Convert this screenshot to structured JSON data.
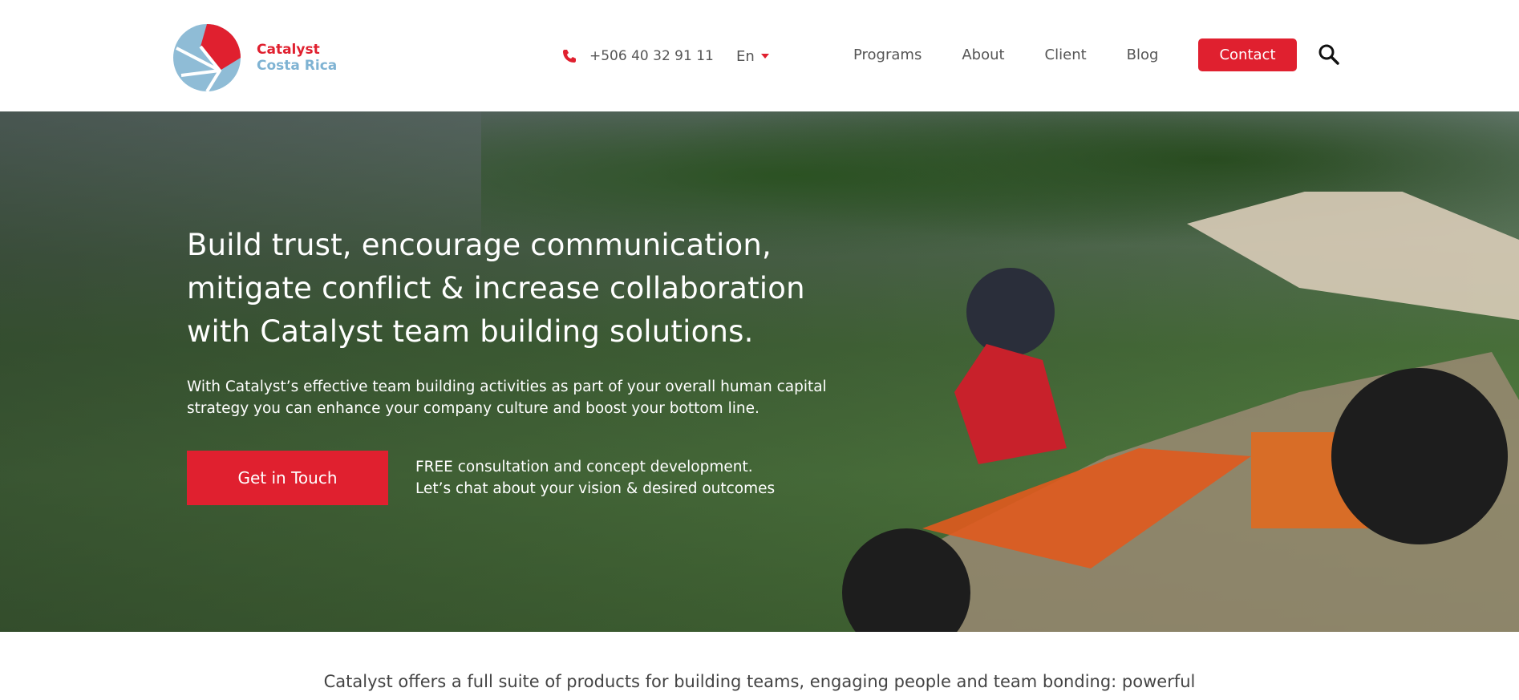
{
  "brand": {
    "name_line1": "Catalyst",
    "name_line2": "Costa Rica",
    "colors": {
      "red": "#e0202f",
      "blue": "#7fb3d3"
    }
  },
  "header": {
    "phone_icon": "phone-icon",
    "phone": "+506 40 32 91 11",
    "language": "En",
    "nav": [
      {
        "label": "Programs"
      },
      {
        "label": "About"
      },
      {
        "label": "Client"
      },
      {
        "label": "Blog"
      }
    ],
    "contact_label": "Contact",
    "search_icon": "search-icon"
  },
  "hero": {
    "title_line1": "Build trust, encourage communication,",
    "title_line2": "mitigate conflict & increase collaboration",
    "title_line3": "with Catalyst team building solutions.",
    "lead_line1": "With Catalyst’s effective team building activities as part of your overall human capital",
    "lead_line2": "strategy you can enhance your company culture and boost your bottom line.",
    "cta_label": "Get in Touch",
    "note_line1": "FREE consultation and concept development.",
    "note_line2": "Let’s chat about your vision & desired outcomes"
  },
  "intro": {
    "text": "Catalyst offers a full suite of products for building teams, engaging people and team bonding: powerful"
  }
}
